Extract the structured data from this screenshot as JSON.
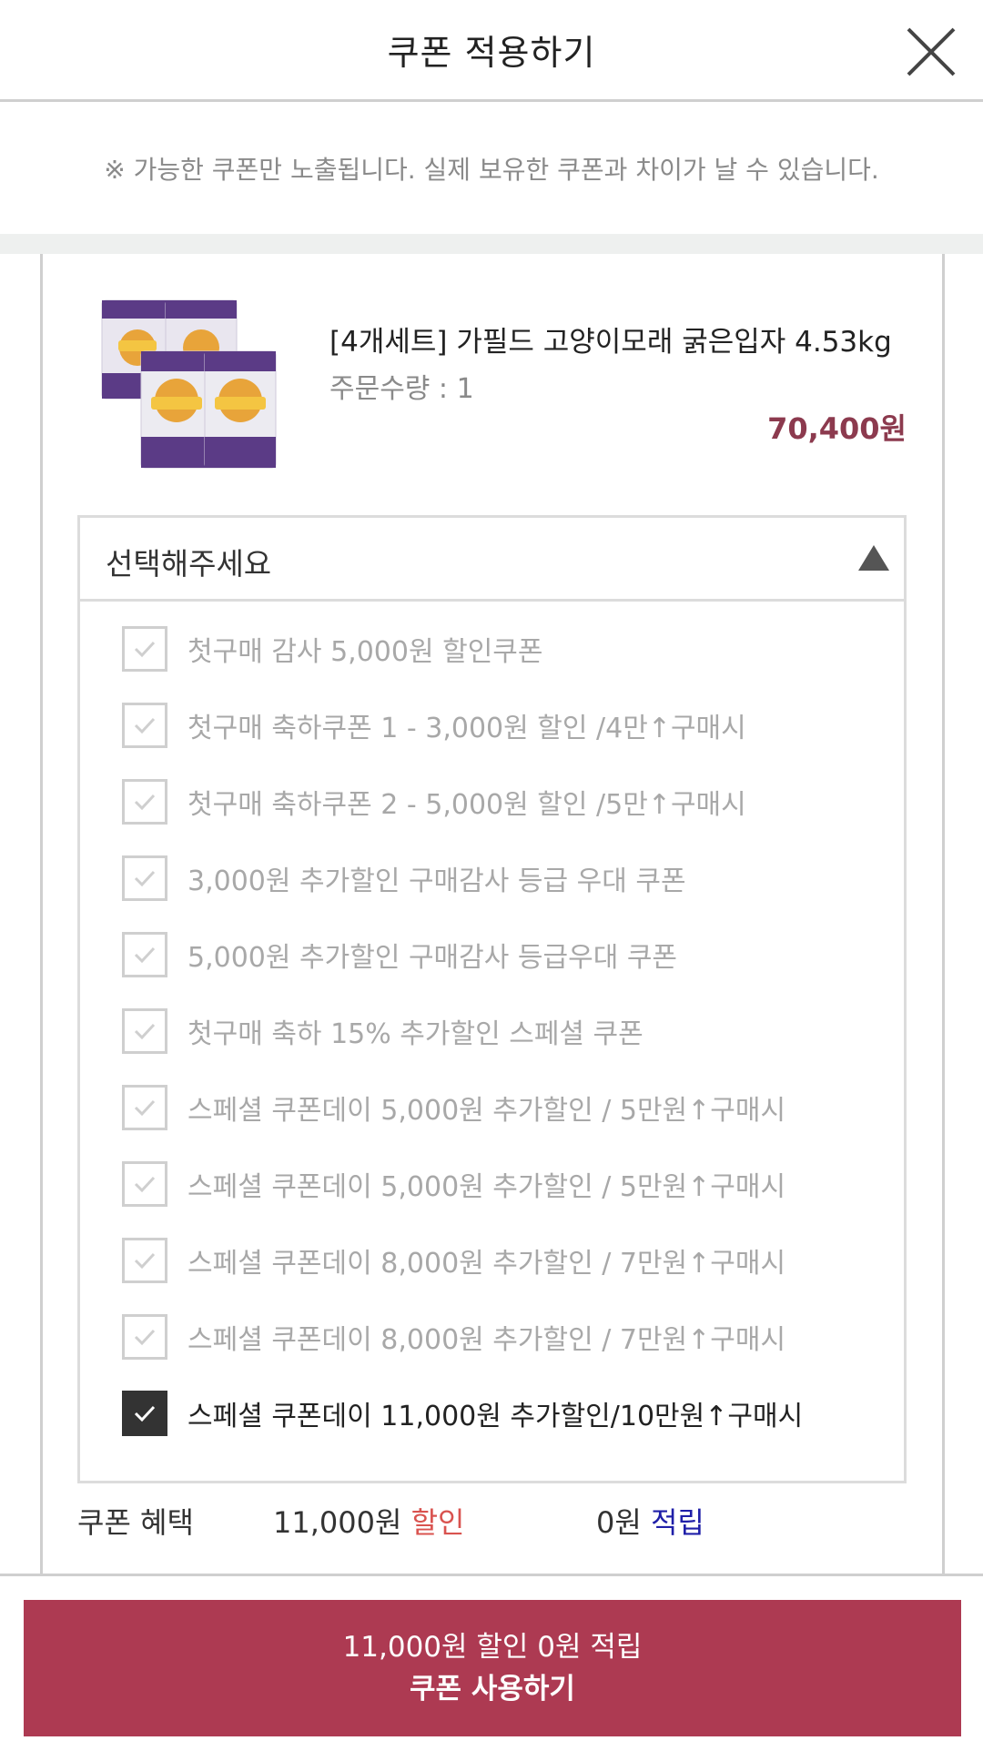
{
  "header": {
    "title": "쿠폰 적용하기",
    "close_icon": "close-icon"
  },
  "notice": "※ 가능한 쿠폰만 노출됩니다. 실제 보유한 쿠폰과 차이가 날 수 있습니다.",
  "product": {
    "name": "[4개세트] 가필드 고양이모래 굵은입자 4.53kg",
    "quantity": "주문수량 : 1",
    "price": "70,400원"
  },
  "dropdown": {
    "placeholder": "선택해주세요",
    "caret_icon": "caret-up-icon",
    "items": [
      {
        "label": "첫구매 감사 5,000원 할인쿠폰",
        "checked": false
      },
      {
        "label": "첫구매 축하쿠폰 1 - 3,000원 할인 /4만↑구매시",
        "checked": false
      },
      {
        "label": "첫구매 축하쿠폰 2 - 5,000원 할인 /5만↑구매시",
        "checked": false
      },
      {
        "label": "3,000원 추가할인 구매감사 등급 우대 쿠폰",
        "checked": false
      },
      {
        "label": "5,000원 추가할인 구매감사 등급우대 쿠폰",
        "checked": false
      },
      {
        "label": "첫구매 축하 15% 추가할인 스페셜 쿠폰",
        "checked": false
      },
      {
        "label": "스페셜 쿠폰데이 5,000원 추가할인 / 5만원↑구매시",
        "checked": false
      },
      {
        "label": "스페셜 쿠폰데이 5,000원 추가할인 / 5만원↑구매시",
        "checked": false
      },
      {
        "label": "스페셜 쿠폰데이 8,000원 추가할인 / 7만원↑구매시",
        "checked": false
      },
      {
        "label": "스페셜 쿠폰데이 8,000원 추가할인 / 7만원↑구매시",
        "checked": false
      },
      {
        "label": "스페셜 쿠폰데이 11,000원 추가할인/10만원↑구매시",
        "checked": true
      }
    ]
  },
  "benefit": {
    "label": "쿠폰 혜택",
    "discount_amount": "11,000원",
    "discount_word": "할인",
    "points_amount": "0원",
    "points_word": "적립"
  },
  "submit": {
    "line1": "11,000원 할인 0원 적립",
    "line2": "쿠폰 사용하기"
  },
  "colors": {
    "accent": "#ad3a52",
    "price": "#8c3a4e",
    "discount": "#d9534f",
    "points": "#1f1fa8"
  }
}
